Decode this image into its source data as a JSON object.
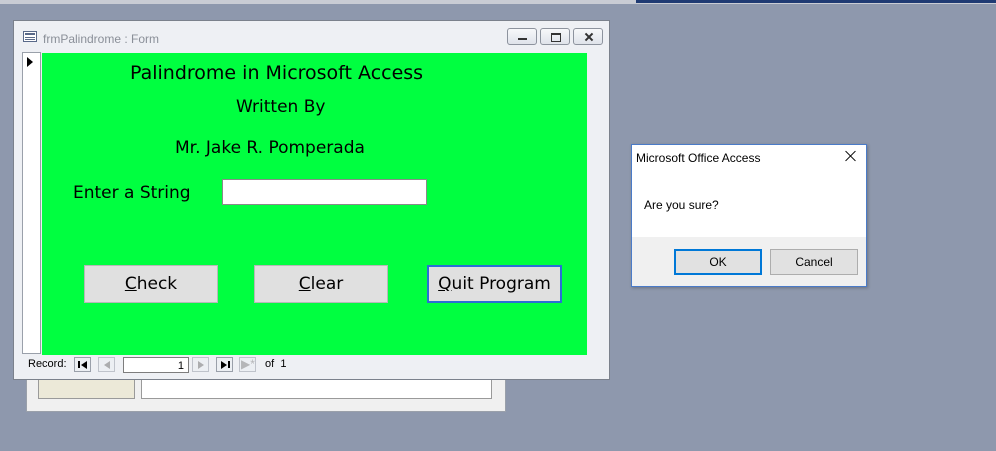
{
  "form_window": {
    "title": "frmPalindrome : Form",
    "heading": "Palindrome in Microsoft Access",
    "written_by": "Written By",
    "author": "Mr. Jake R. Pomperada",
    "input_label": "Enter a String",
    "input_value": "",
    "buttons": {
      "check": {
        "accesskey": "C",
        "rest": "heck"
      },
      "clear": {
        "accesskey": "C",
        "rest": "lear"
      },
      "quit": {
        "accesskey": "Q",
        "rest": "uit Program"
      }
    },
    "background_color": "#00ff40",
    "nav": {
      "label": "Record:",
      "current": "1",
      "of_label": "of",
      "total": "1"
    }
  },
  "dialog": {
    "title": "Microsoft Office Access",
    "message": "Are you sure?",
    "ok_label": "OK",
    "cancel_label": "Cancel"
  }
}
